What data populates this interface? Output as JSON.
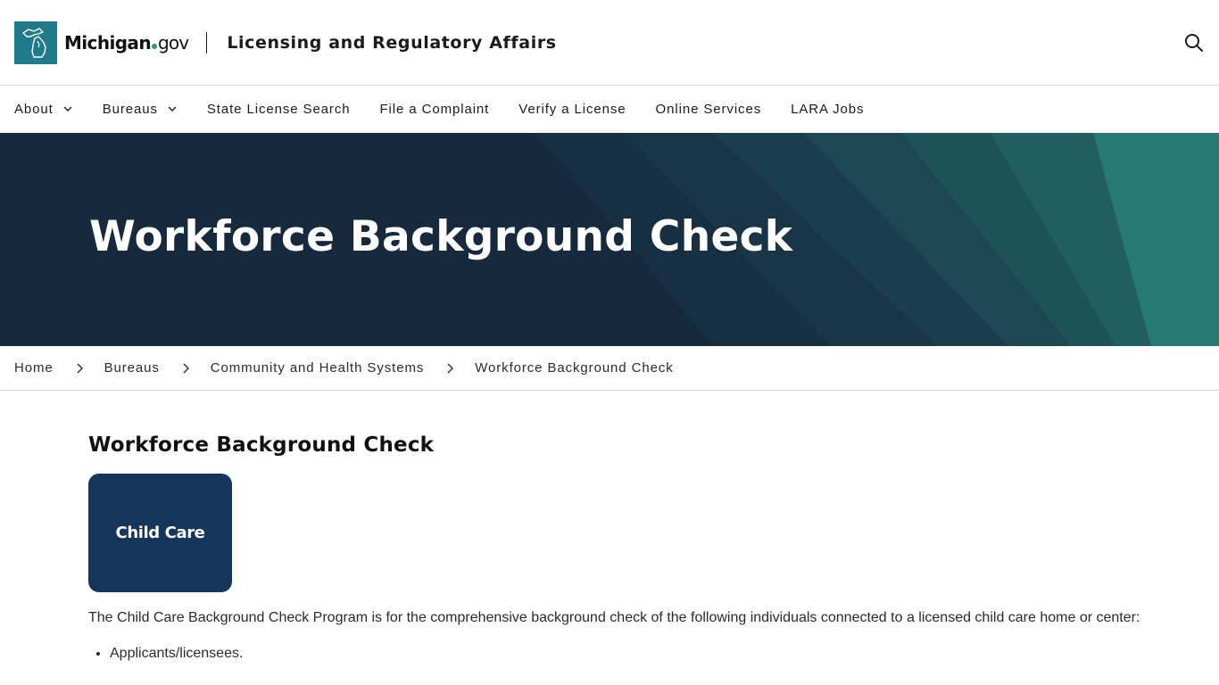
{
  "header": {
    "brand_main": "Michigan",
    "brand_gov": "gov",
    "agency": "Licensing and Regulatory Affairs"
  },
  "nav": {
    "items": [
      {
        "label": "About",
        "has_dropdown": true
      },
      {
        "label": "Bureaus",
        "has_dropdown": true
      },
      {
        "label": "State License Search",
        "has_dropdown": false
      },
      {
        "label": "File a Complaint",
        "has_dropdown": false
      },
      {
        "label": "Verify a License",
        "has_dropdown": false
      },
      {
        "label": "Online Services",
        "has_dropdown": false
      },
      {
        "label": "LARA Jobs",
        "has_dropdown": false
      }
    ]
  },
  "hero": {
    "title": "Workforce Background Check"
  },
  "breadcrumb": {
    "items": [
      "Home",
      "Bureaus",
      "Community and Health Systems",
      "Workforce Background Check"
    ]
  },
  "main": {
    "heading": "Workforce Background Check",
    "tile_label": "Child Care",
    "intro": "The Child Care Background Check Program is for the comprehensive background check of the following individuals connected to a licensed child care home or center:",
    "list": [
      "Applicants/licensees."
    ]
  },
  "colors": {
    "hero_dark": "#16293d",
    "hero_teal": "#267a73",
    "logo_teal": "#1f7a8c",
    "tile_navy": "#14365a"
  },
  "icons": {
    "logo": "michigan-state-outline-icon",
    "search": "search-icon",
    "dropdown": "chevron-down-icon",
    "breadcrumb_separator": "chevron-right-icon"
  }
}
